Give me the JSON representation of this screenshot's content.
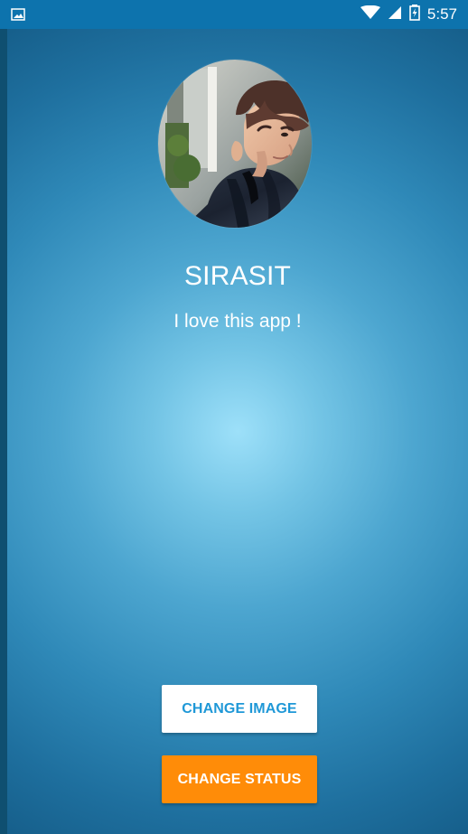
{
  "status_bar": {
    "time": "5:57",
    "icons": [
      "image-notification-icon",
      "wifi-icon",
      "signal-icon",
      "battery-icon"
    ]
  },
  "profile": {
    "name": "SIRASIT",
    "status": "I love this app !"
  },
  "buttons": {
    "change_image": "CHANGE IMAGE",
    "change_status": "CHANGE STATUS"
  },
  "colors": {
    "status_bar": "#0d73ad",
    "background_center": "#9de0f9",
    "background_edge": "#165f8b",
    "primary_text": "#ffffff",
    "change_image_text": "#1f98d7",
    "change_status_bg": "#ff8c08"
  }
}
